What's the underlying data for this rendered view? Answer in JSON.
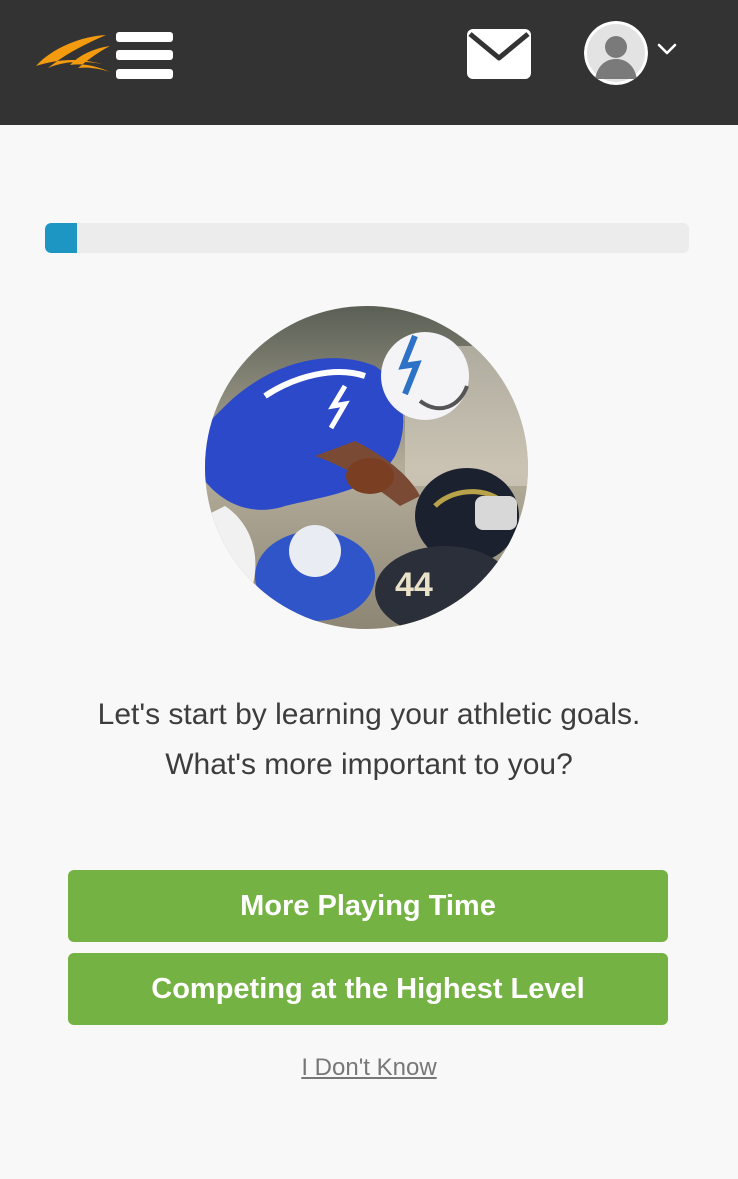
{
  "header": {
    "logo_icon": "brand-swoosh-logo",
    "menu_icon": "hamburger-menu-icon",
    "mail_icon": "envelope-icon",
    "avatar_icon": "user-avatar-icon",
    "chevron_icon": "chevron-down-icon"
  },
  "progress": {
    "value_fraction": 0.05,
    "fill_color": "#1e96c4",
    "track_color": "#ececec"
  },
  "hero": {
    "image": "football-player-jumping-photo"
  },
  "prompt": {
    "line1": "Let's start by learning your athletic goals.",
    "line2": "What's more important to you?"
  },
  "options": {
    "option1_label": "More Playing Time",
    "option2_label": "Competing at the Highest Level",
    "button_color": "#74b243"
  },
  "dont_know": {
    "label": "I Don't Know"
  },
  "colors": {
    "header_bg": "#333333",
    "page_bg": "#f8f8f8",
    "logo_orange": "#f39a0f"
  }
}
